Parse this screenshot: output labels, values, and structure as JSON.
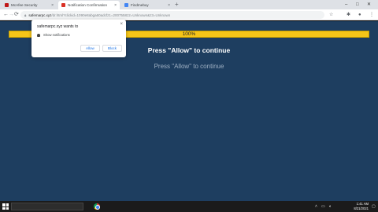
{
  "browser": {
    "tabs": [
      {
        "label": "McAfee Security",
        "favicon_color": "#c01818"
      },
      {
        "label": "Notification Confirmation",
        "favicon_color": "#d93025"
      },
      {
        "label": "Findmebuy",
        "favicon_color": "#4285f4"
      }
    ],
    "new_tab": "+",
    "url_host": "safemarpc.xyz",
    "url_rest": "/dr.html?clickid=1090e8abga60adcfz1=2007558z2=Unknown&z3=Unknown"
  },
  "popup": {
    "title": "safemarpc.xyz wants to",
    "permission": "Show notifications",
    "allow": "Allow",
    "block": "Block",
    "close": "×"
  },
  "page": {
    "progress_label": "100%",
    "progress_value": 100,
    "headline": "Press \"Allow\" to continue",
    "subline": "Press \"Allow\" to continue",
    "background": "#1e3e60",
    "accent": "#f5c518"
  },
  "taskbar": {
    "time": "1:41 AM",
    "date": "8/21/2021"
  }
}
